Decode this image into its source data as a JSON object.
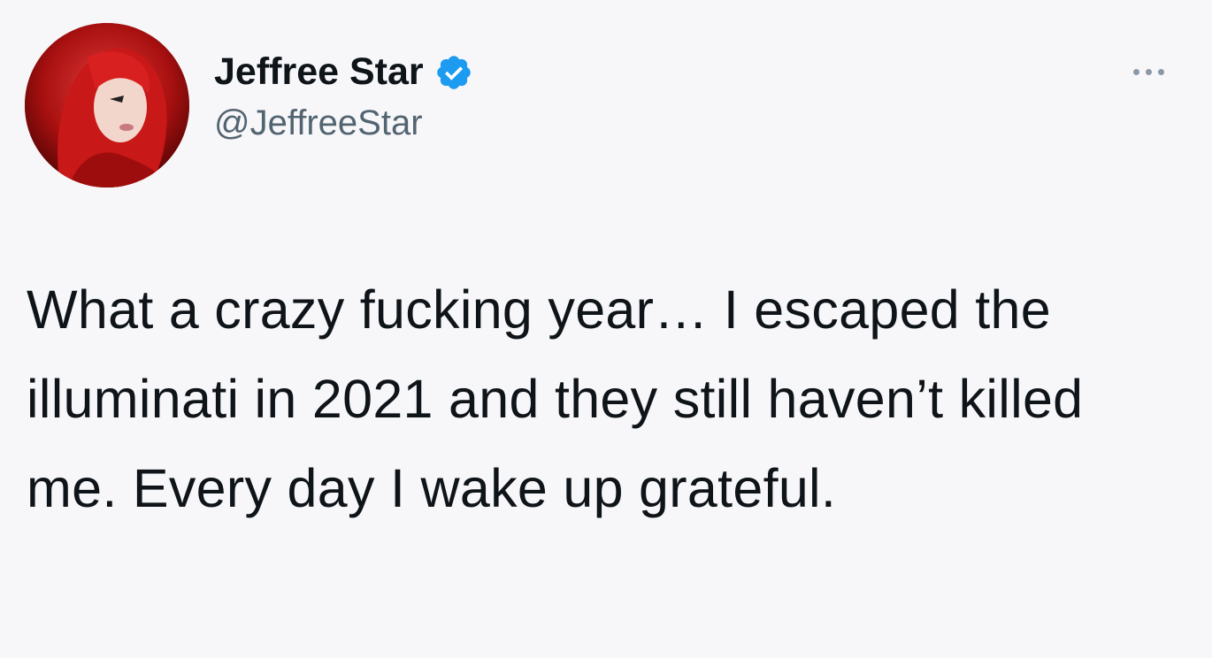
{
  "tweet": {
    "author": {
      "display_name": "Jeffree Star",
      "handle": "@JeffreeStar",
      "verified": true,
      "avatar_icon": "profile-photo",
      "verified_icon": "verified-badge-icon"
    },
    "more_icon": "more-options-icon",
    "text": "What a crazy fucking year… I escaped the illuminati in 2021 and they still haven’t killed me. Every day I wake up grateful."
  },
  "colors": {
    "background": "#f7f7fa",
    "text": "#0f1419",
    "secondary_text": "#536471",
    "verified_blue": "#1d9bf0"
  }
}
